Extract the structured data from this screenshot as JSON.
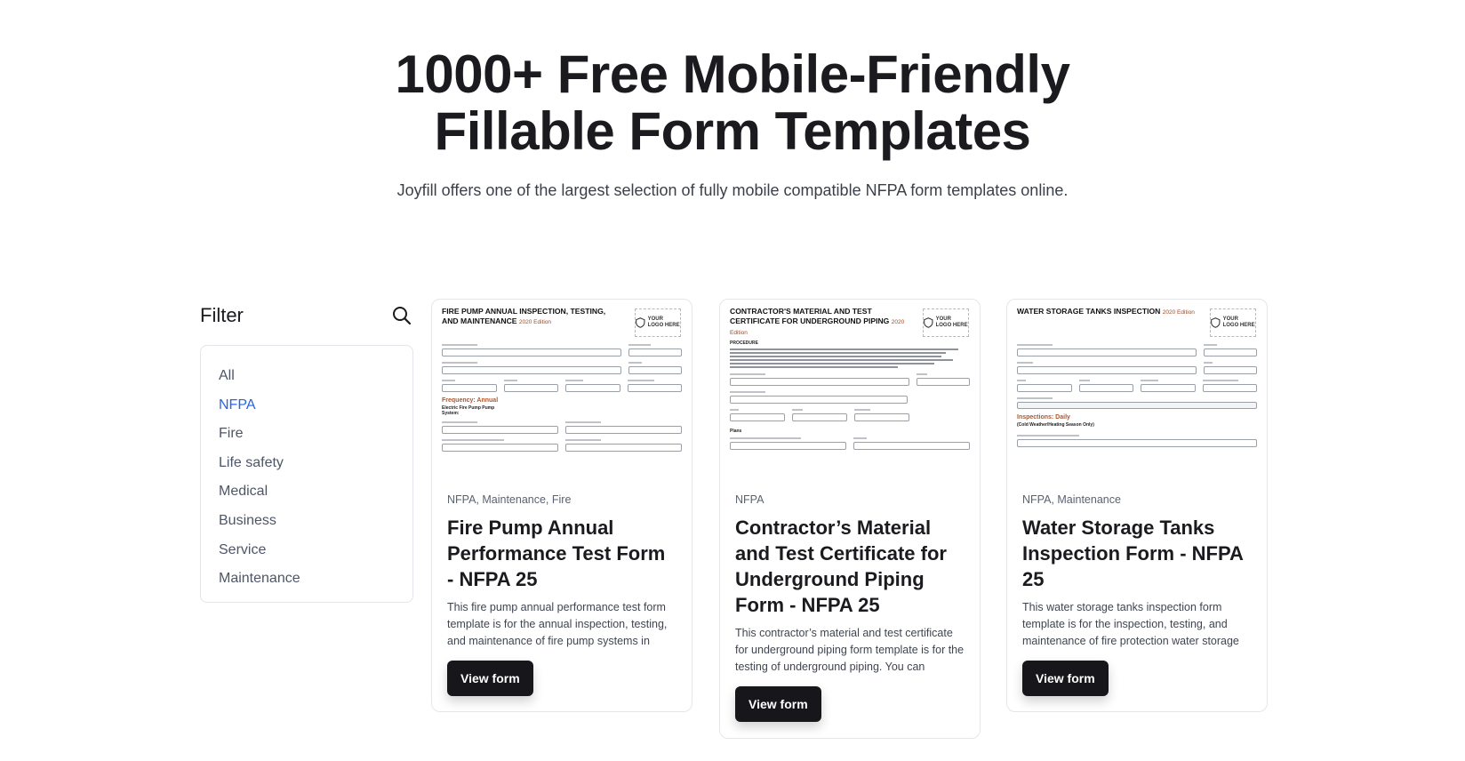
{
  "hero": {
    "title": "1000+ Free Mobile-Friendly Fillable Form Templates",
    "subtitle": "Joyfill offers one of the largest selection of fully mobile compatible NFPA form templates online."
  },
  "filter": {
    "title": "Filter",
    "search_icon": "search-icon",
    "active": "NFPA",
    "items": [
      "All",
      "NFPA",
      "Fire",
      "Life safety",
      "Medical",
      "Business",
      "Service",
      "Maintenance"
    ]
  },
  "cards": [
    {
      "thumb_title": "FIRE PUMP ANNUAL INSPECTION, TESTING, AND MAINTENANCE",
      "thumb_edition": "2020 Edition",
      "thumb_section": "Frequency: Annual",
      "thumb_sub": "Electric Fire Pump Pump System:",
      "tags": "NFPA, Maintenance, Fire",
      "title": "Fire Pump Annual Performance Test Form - NFPA 25",
      "description": "This fire pump annual performance test form template is for the annual inspection, testing, and maintenance of fire pump systems in",
      "button": "View form"
    },
    {
      "thumb_title": "CONTRACTOR'S MATERIAL AND TEST CERTIFICATE FOR UNDERGROUND PIPING",
      "thumb_edition": "2020 Edition",
      "thumb_section": "PROCEDURE",
      "thumb_sub": "Plans",
      "tags": "NFPA",
      "title": "Contractor’s Material and Test Certificate for Underground Piping Form - NFPA 25",
      "description": "This contractor’s material and test certificate for underground piping form template is for the testing of underground piping. You can",
      "button": "View form"
    },
    {
      "thumb_title": "WATER STORAGE TANKS INSPECTION",
      "thumb_edition": "2020 Edition",
      "thumb_section": "Inspections: Daily",
      "thumb_sub": "(Cold Weather/Heating Season Only)",
      "tags": "NFPA, Maintenance",
      "title": "Water Storage Tanks Inspection Form - NFPA 25",
      "description": "This water storage tanks inspection form template is for the inspection, testing, and maintenance of fire protection water storage",
      "button": "View form"
    }
  ],
  "logo_placeholder": "YOUR LOGO HERE"
}
